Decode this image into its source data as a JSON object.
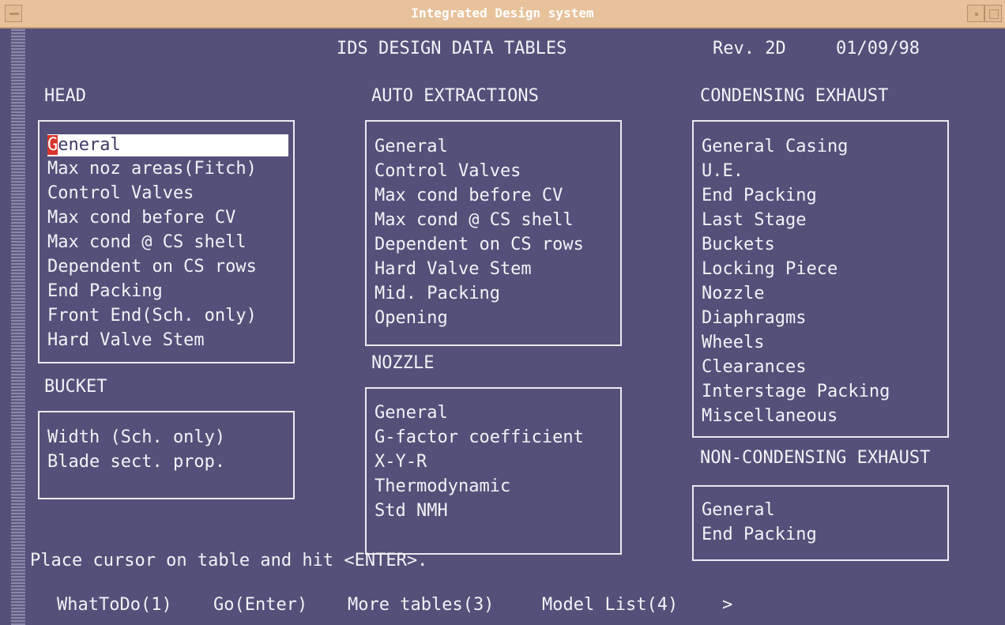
{
  "window": {
    "title": "Integrated Design system"
  },
  "header": {
    "title": "IDS DESIGN DATA TABLES",
    "rev": "Rev. 2D",
    "date": "01/09/98"
  },
  "sections": {
    "head": {
      "heading": "HEAD",
      "items": [
        {
          "cursor_char": "G",
          "rest": "eneral"
        },
        {
          "label": "Max noz areas(Fitch)"
        },
        {
          "label": "Control Valves"
        },
        {
          "label": "Max cond before CV"
        },
        {
          "label": "Max cond @ CS shell"
        },
        {
          "label": "Dependent on CS rows"
        },
        {
          "label": "End Packing"
        },
        {
          "label": "Front End(Sch. only)"
        },
        {
          "label": "Hard Valve Stem"
        }
      ]
    },
    "bucket": {
      "heading": "BUCKET",
      "items": [
        {
          "label": "Width (Sch. only)"
        },
        {
          "label": "Blade sect. prop."
        }
      ]
    },
    "auto_extractions": {
      "heading": "AUTO EXTRACTIONS",
      "items": [
        {
          "label": "General"
        },
        {
          "label": "Control Valves"
        },
        {
          "label": "Max cond before CV"
        },
        {
          "label": "Max cond @ CS shell"
        },
        {
          "label": "Dependent on CS rows"
        },
        {
          "label": "Hard Valve Stem"
        },
        {
          "label": "Mid. Packing"
        },
        {
          "label": "Opening"
        }
      ]
    },
    "nozzle": {
      "heading": "NOZZLE",
      "items": [
        {
          "label": "General"
        },
        {
          "label": "G-factor coefficient"
        },
        {
          "label": "X-Y-R"
        },
        {
          "label": "Thermodynamic"
        },
        {
          "label": "Std NMH"
        }
      ]
    },
    "condensing_exhaust": {
      "heading": "CONDENSING EXHAUST",
      "items": [
        {
          "label": "General Casing"
        },
        {
          "label": "U.E."
        },
        {
          "label": "End Packing"
        },
        {
          "label": "Last Stage"
        },
        {
          "label": "Buckets"
        },
        {
          "label": "Locking Piece"
        },
        {
          "label": "Nozzle"
        },
        {
          "label": "Diaphragms"
        },
        {
          "label": "Wheels"
        },
        {
          "label": "Clearances"
        },
        {
          "label": "Interstage Packing"
        },
        {
          "label": "Miscellaneous"
        }
      ]
    },
    "non_condensing_exhaust": {
      "heading": "NON-CONDENSING EXHAUST",
      "items": [
        {
          "label": "General"
        },
        {
          "label": "End Packing"
        }
      ]
    }
  },
  "status": "Place cursor on table and hit <ENTER>.",
  "function_keys": [
    {
      "label": "WhatToDo(1)"
    },
    {
      "label": "Go(Enter)"
    },
    {
      "label": "More tables(3)"
    },
    {
      "label": "Model List(4)"
    },
    {
      "label": ">"
    }
  ]
}
